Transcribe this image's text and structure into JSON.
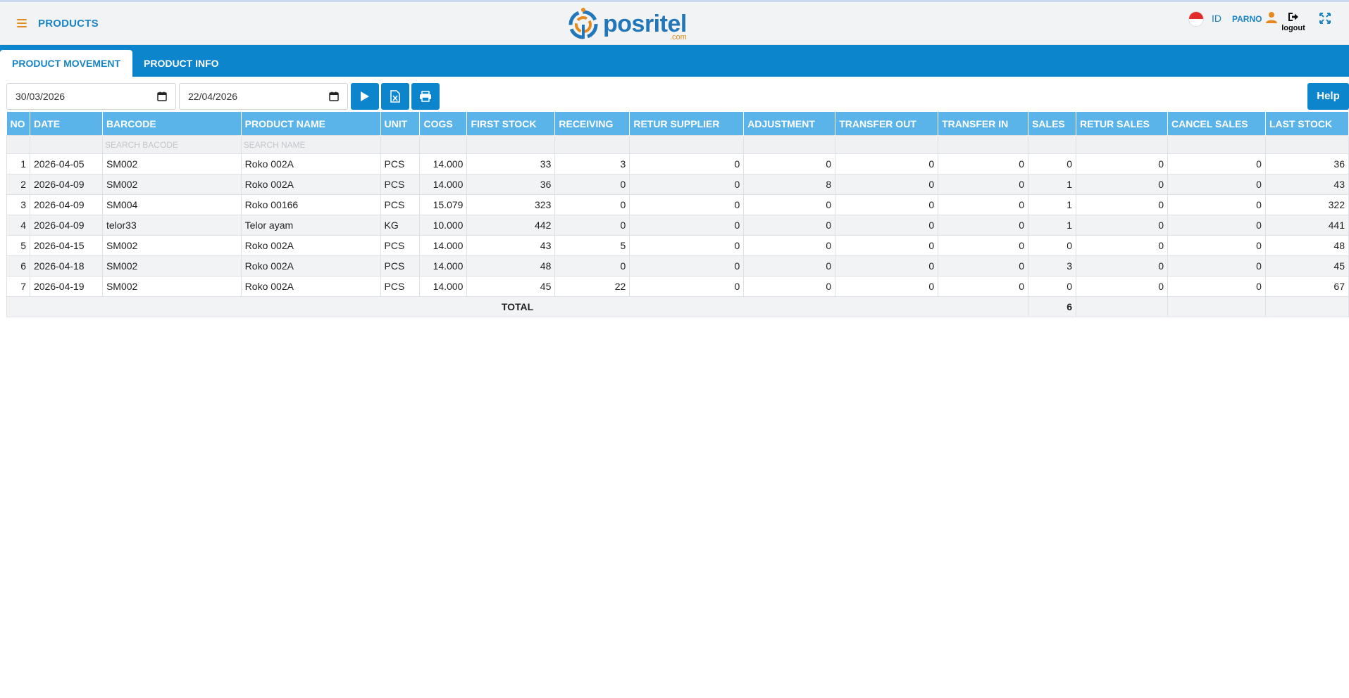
{
  "header": {
    "title": "PRODUCTS",
    "logo_text": "posritel",
    "logo_sub": ".com",
    "language_code": "ID",
    "user_name": "PARNO",
    "logout_label": "logout"
  },
  "tabs": [
    {
      "label": "PRODUCT MOVEMENT",
      "active": true
    },
    {
      "label": "PRODUCT INFO",
      "active": false
    }
  ],
  "toolbar": {
    "date_from": "30/03/2026",
    "date_to": "22/04/2026",
    "help_label": "Help"
  },
  "table": {
    "columns": [
      "NO",
      "DATE",
      "BARCODE",
      "PRODUCT NAME",
      "UNIT",
      "COGS",
      "FIRST STOCK",
      "RECEIVING",
      "RETUR SUPPLIER",
      "ADJUSTMENT",
      "TRANSFER OUT",
      "TRANSFER IN",
      "SALES",
      "RETUR SALES",
      "CANCEL SALES",
      "LAST STOCK"
    ],
    "search_placeholders": {
      "barcode": "SEARCH BACODE",
      "name": "SEARCH NAME"
    },
    "rows": [
      [
        "1",
        "2026-04-05",
        "SM002",
        "Roko 002A",
        "PCS",
        "14.000",
        "33",
        "3",
        "0",
        "0",
        "0",
        "0",
        "0",
        "0",
        "0",
        "36"
      ],
      [
        "2",
        "2026-04-09",
        "SM002",
        "Roko 002A",
        "PCS",
        "14.000",
        "36",
        "0",
        "0",
        "8",
        "0",
        "0",
        "1",
        "0",
        "0",
        "43"
      ],
      [
        "3",
        "2026-04-09",
        "SM004",
        "Roko 00166",
        "PCS",
        "15.079",
        "323",
        "0",
        "0",
        "0",
        "0",
        "0",
        "1",
        "0",
        "0",
        "322"
      ],
      [
        "4",
        "2026-04-09",
        "telor33",
        "Telor ayam",
        "KG",
        "10.000",
        "442",
        "0",
        "0",
        "0",
        "0",
        "0",
        "1",
        "0",
        "0",
        "441"
      ],
      [
        "5",
        "2026-04-15",
        "SM002",
        "Roko 002A",
        "PCS",
        "14.000",
        "43",
        "5",
        "0",
        "0",
        "0",
        "0",
        "0",
        "0",
        "0",
        "48"
      ],
      [
        "6",
        "2026-04-18",
        "SM002",
        "Roko 002A",
        "PCS",
        "14.000",
        "48",
        "0",
        "0",
        "0",
        "0",
        "0",
        "3",
        "0",
        "0",
        "45"
      ],
      [
        "7",
        "2026-04-19",
        "SM002",
        "Roko 002A",
        "PCS",
        "14.000",
        "45",
        "22",
        "0",
        "0",
        "0",
        "0",
        "0",
        "0",
        "0",
        "67"
      ]
    ],
    "total_label": "TOTAL",
    "total_sales": "6"
  },
  "colors": {
    "brand_blue": "#0d85cc",
    "header_blue": "#5bb4e9",
    "accent_orange": "#e58a1f"
  }
}
